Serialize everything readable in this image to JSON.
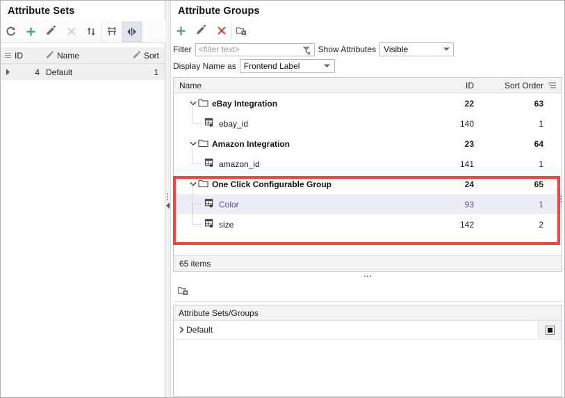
{
  "left_panel": {
    "title": "Attribute Sets",
    "toolbar": [
      {
        "name": "refresh-button",
        "icon": "refresh-icon",
        "enabled": true
      },
      {
        "name": "add-button",
        "icon": "plus-icon",
        "enabled": true
      },
      {
        "name": "edit-button",
        "icon": "pencil-icon",
        "enabled": true
      },
      {
        "name": "delete-button",
        "icon": "close-x-icon",
        "enabled": false
      },
      {
        "name": "sort-button",
        "icon": "sort-updown-icon",
        "enabled": true
      },
      {
        "name": "fit-columns-button",
        "icon": "fit-columns-icon",
        "enabled": true
      },
      {
        "name": "toggle-panel-button",
        "icon": "split-panel-icon",
        "enabled": true,
        "pressed": true
      }
    ],
    "columns": [
      "ID",
      "Name",
      "Sort"
    ],
    "rows": [
      {
        "id": "4",
        "name": "Default",
        "sort": "1"
      }
    ]
  },
  "right_panel": {
    "title": "Attribute Groups",
    "toolbar": [
      {
        "name": "add-group-button",
        "icon": "plus-icon"
      },
      {
        "name": "edit-group-button",
        "icon": "pencil-icon"
      },
      {
        "name": "delete-group-button",
        "icon": "close-x-icon"
      },
      {
        "name": "copy-group-button",
        "icon": "copy-folder-icon"
      }
    ],
    "filter": {
      "label": "Filter",
      "value": "",
      "placeholder": "<filter text>",
      "clear_icon": "funnel-clear-icon"
    },
    "show_attributes": {
      "label": "Show Attributes",
      "value": "Visible"
    },
    "display_name_as": {
      "label": "Display Name as",
      "value": "Frontend Label"
    },
    "tree": {
      "columns": {
        "name": "Name",
        "id": "ID",
        "sort_order": "Sort Order",
        "menu_icon": "column-menu-icon"
      },
      "rows": [
        {
          "type": "group",
          "label": "eBay Integration",
          "id": "22",
          "sort": "63",
          "expanded": true,
          "selected": false
        },
        {
          "type": "attr",
          "label": "ebay_id",
          "id": "140",
          "sort": "1",
          "selected": false
        },
        {
          "type": "group",
          "label": "Amazon Integration",
          "id": "23",
          "sort": "64",
          "expanded": true,
          "selected": false
        },
        {
          "type": "attr",
          "label": "amazon_id",
          "id": "141",
          "sort": "1",
          "selected": false
        },
        {
          "type": "group",
          "label": "One Click Configurable Group",
          "id": "24",
          "sort": "65",
          "expanded": true,
          "selected": false
        },
        {
          "type": "attr",
          "label": "Color",
          "id": "93",
          "sort": "1",
          "selected": true
        },
        {
          "type": "attr",
          "label": "size",
          "id": "142",
          "sort": "2",
          "selected": false
        }
      ],
      "status": "65 items"
    },
    "lower_toolbar": [
      {
        "name": "add-attribute-set-group-button",
        "icon": "add-folder-icon"
      }
    ],
    "bottom": {
      "title": "Attribute Sets/Groups",
      "rows": [
        {
          "label": "Default",
          "expanded": false,
          "checked": true
        }
      ]
    }
  },
  "annotation": {
    "highlight_color": "#f2453b",
    "name": "red-highlight-box"
  },
  "colors": {
    "accent_green": "#4caf50",
    "accent_red": "#e0433c",
    "selection_bg": "#eceef5",
    "selection_text": "#4a4ab0",
    "header_bg": "#f3f3f3"
  }
}
